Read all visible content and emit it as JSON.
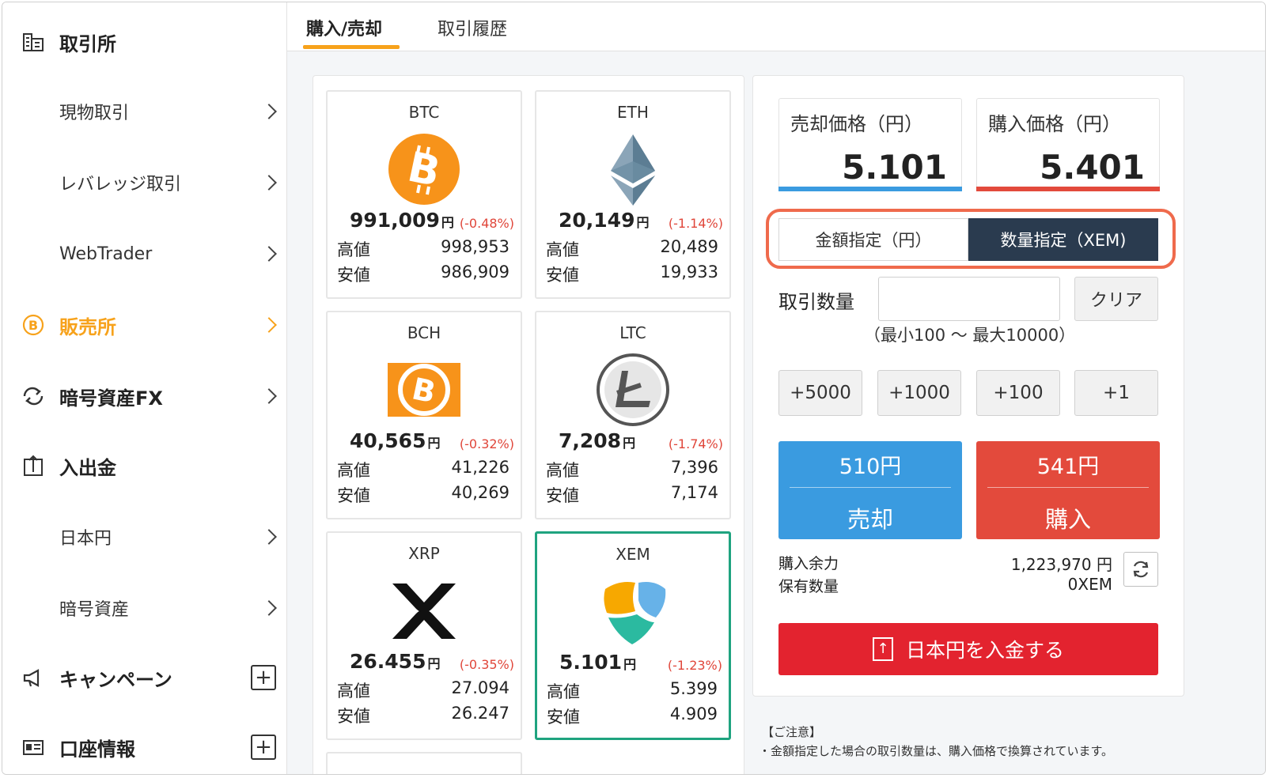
{
  "sidebar": {
    "exchange": {
      "label": "取引所",
      "icon": "building-icon"
    },
    "spot": "現物取引",
    "leverage": "レバレッジ取引",
    "webtrader": "WebTrader",
    "sales": {
      "label": "販売所",
      "icon": "bitcoin-icon"
    },
    "crypto_fx": {
      "label": "暗号資産FX",
      "icon": "exchange-arrows-icon"
    },
    "deposit_withdraw": {
      "label": "入出金",
      "icon": "deposit-icon"
    },
    "jpy": "日本円",
    "crypto": "暗号資産",
    "campaign": {
      "label": "キャンペーン",
      "icon": "megaphone-icon"
    },
    "account": {
      "label": "口座情報",
      "icon": "id-card-icon"
    }
  },
  "tabs": {
    "buy_sell": "購入/売却",
    "history": "取引履歴"
  },
  "coins": [
    {
      "symbol": "BTC",
      "price": "991,009",
      "yen": "円",
      "change": "(-0.48%)",
      "high_label": "高値",
      "high": "998,953",
      "low_label": "安値",
      "low": "986,909"
    },
    {
      "symbol": "ETH",
      "price": "20,149",
      "yen": "円",
      "change": "(-1.14%)",
      "high_label": "高値",
      "high": "20,489",
      "low_label": "安値",
      "low": "19,933"
    },
    {
      "symbol": "BCH",
      "price": "40,565",
      "yen": "円",
      "change": "(-0.32%)",
      "high_label": "高値",
      "high": "41,226",
      "low_label": "安値",
      "low": "40,269"
    },
    {
      "symbol": "LTC",
      "price": "7,208",
      "yen": "円",
      "change": "(-1.74%)",
      "high_label": "高値",
      "high": "7,396",
      "low_label": "安値",
      "low": "7,174"
    },
    {
      "symbol": "XRP",
      "price": "26.455",
      "yen": "円",
      "change": "(-0.35%)",
      "high_label": "高値",
      "high": "27.094",
      "low_label": "安値",
      "low": "26.247"
    },
    {
      "symbol": "XEM",
      "price": "5.101",
      "yen": "円",
      "change": "(-1.23%)",
      "high_label": "高値",
      "high": "5.399",
      "low_label": "安値",
      "low": "4.909"
    }
  ],
  "trade": {
    "sell_price_label": "売却価格（円）",
    "sell_price": "5.101",
    "buy_price_label": "購入価格（円）",
    "buy_price": "5.401",
    "mode_amount": "金額指定（円）",
    "mode_quantity": "数量指定（XEM)",
    "qty_label": "取引数量",
    "qty_value": "",
    "clear": "クリア",
    "range_note": "（最小100 〜 最大10000）",
    "inc": [
      "+5000",
      "+1000",
      "+100",
      "+1"
    ],
    "sell_amount": "510円",
    "sell_label": "売却",
    "buy_amount": "541円",
    "buy_label": "購入",
    "available_label": "購入余力",
    "available_value": "1,223,970 円",
    "holding_label": "保有数量",
    "holding_value": "0XEM",
    "deposit_button": "日本円を入金する"
  },
  "notice": {
    "title": "【ご注意】",
    "body": "・金額指定した場合の取引数量は、購入価格で換算されています。"
  },
  "colors": {
    "accent_orange": "#f7a21b",
    "sell_blue": "#3a9be0",
    "buy_red": "#e34a3c",
    "deposit_red": "#e3232f",
    "selected_green": "#1fa37f",
    "mode_active": "#2a3b4f",
    "highlight_outline": "#ef6a4c"
  }
}
